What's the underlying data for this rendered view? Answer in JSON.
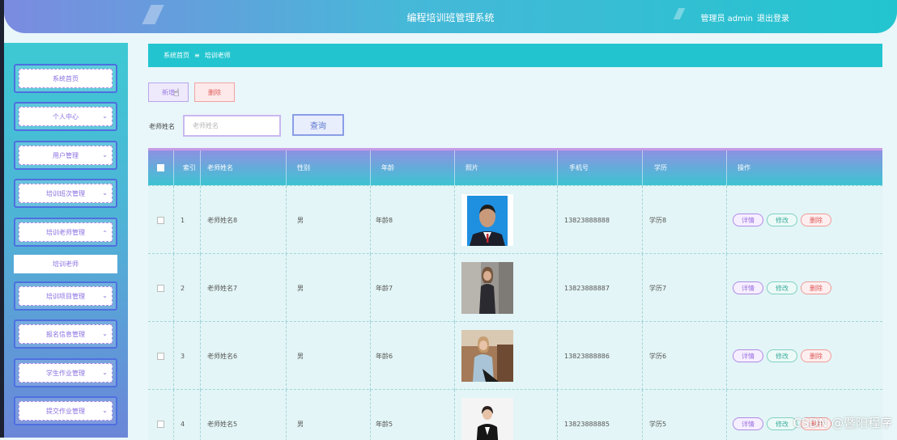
{
  "header": {
    "title": "编程培训班管理系统",
    "user_label": "管理员 admin",
    "logout_label": "退出登录"
  },
  "sidebar": {
    "items": [
      {
        "label": "系统首页",
        "has_chevron": false
      },
      {
        "label": "个人中心",
        "has_chevron": true
      },
      {
        "label": "用户管理",
        "has_chevron": true
      },
      {
        "label": "培训班次管理",
        "has_chevron": true
      },
      {
        "label": "培训老师管理",
        "has_chevron": true,
        "expanded": true
      },
      {
        "label": "培训项目管理",
        "has_chevron": true
      },
      {
        "label": "报名信息管理",
        "has_chevron": true
      },
      {
        "label": "学生作业管理",
        "has_chevron": true
      },
      {
        "label": "提交作业管理",
        "has_chevron": true
      }
    ],
    "active_sub": "培训老师"
  },
  "breadcrumb": {
    "home": "系统首页",
    "separator": "≡",
    "current": "培训老师"
  },
  "toolbar": {
    "add_label": "新增",
    "delete_label": "删除"
  },
  "search": {
    "label": "老师姓名",
    "placeholder": "老师姓名",
    "value": "",
    "query_label": "查询"
  },
  "table": {
    "columns": [
      "索引",
      "老师姓名",
      "性别",
      "年龄",
      "照片",
      "手机号",
      "学历",
      "操作"
    ],
    "rows": [
      {
        "index": "1",
        "name": "老师姓名8",
        "gender": "男",
        "age": "年龄8",
        "phone": "13823888888",
        "education": "学历8",
        "photo": "id-photo-man"
      },
      {
        "index": "2",
        "name": "老师姓名7",
        "gender": "男",
        "age": "年龄7",
        "phone": "13823888887",
        "education": "学历7",
        "photo": "woman-dark-suit"
      },
      {
        "index": "3",
        "name": "老师姓名6",
        "gender": "男",
        "age": "年龄6",
        "phone": "13823888886",
        "education": "学历6",
        "photo": "woman-light-blouse"
      },
      {
        "index": "4",
        "name": "老师姓名5",
        "gender": "男",
        "age": "年龄5",
        "phone": "13823888885",
        "education": "学历5",
        "photo": "woman-black-suit"
      }
    ],
    "actions": {
      "detail": "详情",
      "edit": "修改",
      "delete": "删除"
    }
  },
  "watermark": "CSDN @暨阳程序",
  "colors": {
    "accent": "#22c5cf",
    "sidebar_border": "#4e6fe0",
    "menu_text": "#8a6fe0"
  }
}
